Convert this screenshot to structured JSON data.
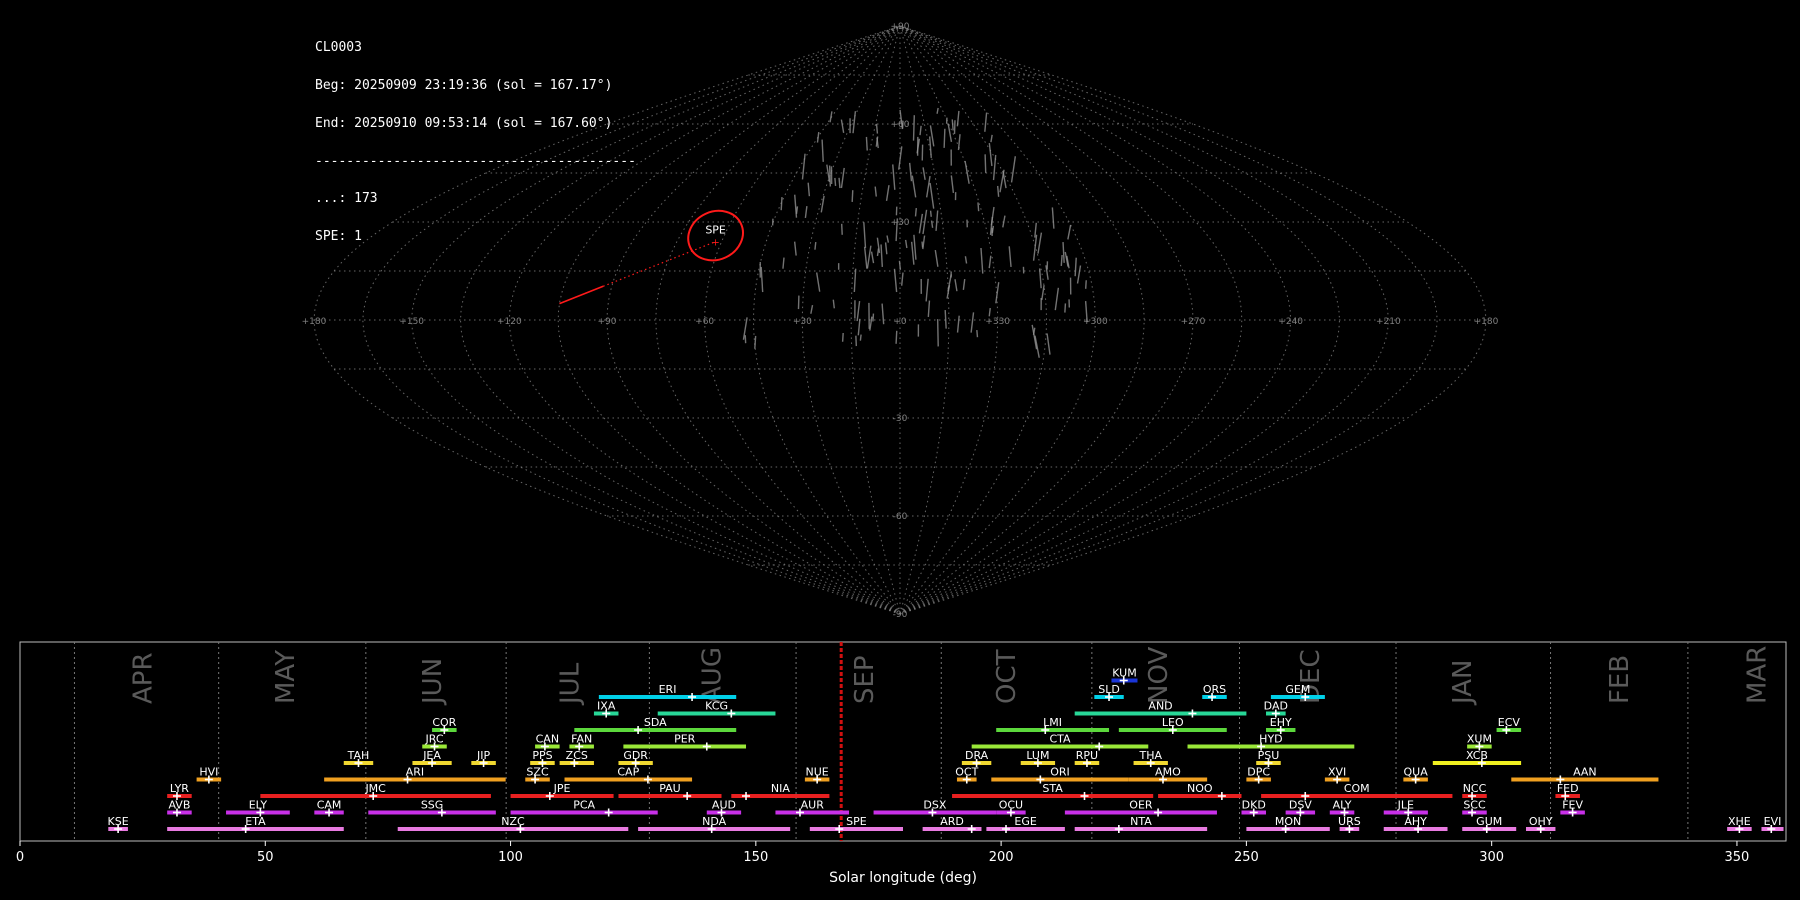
{
  "header": {
    "lines": [
      "CL0003",
      "Beg: 20250909 23:19:36 (sol = 167.17°)",
      "End: 20250910 09:53:14 (sol = 167.60°)",
      "-----------------------------------------",
      "...: 173",
      "SPE: 1"
    ]
  },
  "colors": {
    "background": "#000000",
    "grid": "#808080",
    "highlight": "#ff1a1a",
    "meteor": "#9a9a9a"
  },
  "sky_map": {
    "projection": "sinusoidal",
    "ra_labels": [
      "+180",
      "+150",
      "+120",
      "+90",
      "+60",
      "+30",
      "+0",
      "+330",
      "+300",
      "+270",
      "+240",
      "+210",
      "+180"
    ],
    "dec_labels": [
      "+90",
      "+60",
      "+30",
      "-30",
      "-60",
      "-90"
    ],
    "highlight_shower": {
      "code": "SPE",
      "ra": 62,
      "dec": 24
    },
    "highlight_meteor": {
      "ra_start": 105,
      "dec_start": 5,
      "ra_end": 62,
      "dec_end": 24
    }
  },
  "chart_data": {
    "type": "timeline",
    "xlabel": "Solar longitude (deg)",
    "xlim": [
      0,
      360
    ],
    "xticks": [
      0,
      50,
      100,
      150,
      200,
      250,
      300,
      350
    ],
    "current_sol": 167.4,
    "months": [
      {
        "label": "APR",
        "start": 11.1,
        "center": 25
      },
      {
        "label": "MAY",
        "start": 40.5,
        "center": 54
      },
      {
        "label": "JUN",
        "start": 70.5,
        "center": 84
      },
      {
        "label": "JUL",
        "start": 99.1,
        "center": 112
      },
      {
        "label": "AUG",
        "start": 128.3,
        "center": 141
      },
      {
        "label": "SEP",
        "start": 158.2,
        "center": 172
      },
      {
        "label": "OCT",
        "start": 187.8,
        "center": 201
      },
      {
        "label": "NOV",
        "start": 218.5,
        "center": 232
      },
      {
        "label": "DEC",
        "start": 248.6,
        "center": 263
      },
      {
        "label": "JAN",
        "start": 280.5,
        "center": 294
      },
      {
        "label": "FEB",
        "start": 312,
        "center": 326
      },
      {
        "label": "MAR",
        "start": 340,
        "center": 354
      }
    ],
    "showers": [
      {
        "code": "KUM",
        "start": 222.5,
        "end": 227.8,
        "peak": 225,
        "row": 10,
        "color": "#1a35d8"
      },
      {
        "code": "ERI",
        "start": 118,
        "end": 146,
        "peak": 137,
        "row": 9,
        "color": "#00d0e8"
      },
      {
        "code": "SLD",
        "start": 219,
        "end": 225,
        "peak": 222,
        "row": 9,
        "color": "#00d0e8"
      },
      {
        "code": "ORS",
        "start": 241,
        "end": 246,
        "peak": 243,
        "row": 9,
        "color": "#00d0e8"
      },
      {
        "code": "GEM",
        "start": 255,
        "end": 266,
        "peak": 262,
        "row": 9,
        "color": "#00d0e8"
      },
      {
        "code": "IXA",
        "start": 117,
        "end": 122,
        "peak": 119.5,
        "row": 8,
        "color": "#28d898"
      },
      {
        "code": "KCG",
        "start": 130,
        "end": 154,
        "peak": 145,
        "row": 8,
        "color": "#28d898"
      },
      {
        "code": "AND",
        "start": 215,
        "end": 250,
        "peak": 239,
        "row": 8,
        "color": "#28d898"
      },
      {
        "code": "DAD",
        "start": 254,
        "end": 258,
        "peak": 256,
        "row": 8,
        "color": "#28d898"
      },
      {
        "code": "COR",
        "start": 84,
        "end": 89,
        "peak": 86.5,
        "row": 7,
        "color": "#5cd83c"
      },
      {
        "code": "SDA",
        "start": 113,
        "end": 146,
        "peak": 126,
        "row": 7,
        "color": "#5cd83c"
      },
      {
        "code": "LMI",
        "start": 199,
        "end": 222,
        "peak": 209,
        "row": 7,
        "color": "#5cd83c"
      },
      {
        "code": "LEO",
        "start": 224,
        "end": 246,
        "peak": 235,
        "row": 7,
        "color": "#5cd83c"
      },
      {
        "code": "EHY",
        "start": 254,
        "end": 260,
        "peak": 257,
        "row": 7,
        "color": "#5cd83c"
      },
      {
        "code": "ECV",
        "start": 301,
        "end": 306,
        "peak": 303,
        "row": 7,
        "color": "#5cd83c"
      },
      {
        "code": "JRC",
        "start": 82,
        "end": 87,
        "peak": 84.5,
        "row": 6,
        "color": "#9ae838"
      },
      {
        "code": "CAN",
        "start": 105,
        "end": 110,
        "peak": 107,
        "row": 6,
        "color": "#9ae838"
      },
      {
        "code": "FAN",
        "start": 112,
        "end": 117,
        "peak": 114,
        "row": 6,
        "color": "#9ae838"
      },
      {
        "code": "PER",
        "start": 123,
        "end": 148,
        "peak": 140,
        "row": 6,
        "color": "#9ae838"
      },
      {
        "code": "CTA",
        "start": 194,
        "end": 230,
        "peak": 220,
        "row": 6,
        "color": "#9ae838"
      },
      {
        "code": "HYD",
        "start": 238,
        "end": 272,
        "peak": 253,
        "row": 6,
        "color": "#9ae838"
      },
      {
        "code": "XUM",
        "start": 295,
        "end": 300,
        "peak": 297.5,
        "row": 6,
        "color": "#9ae838"
      },
      {
        "code": "TAH",
        "start": 66,
        "end": 72,
        "peak": 69,
        "row": 5,
        "color": "#f0d830"
      },
      {
        "code": "JEA",
        "start": 80,
        "end": 88,
        "peak": 84,
        "row": 5,
        "color": "#f0d830"
      },
      {
        "code": "JIP",
        "start": 92,
        "end": 97,
        "peak": 94.5,
        "row": 5,
        "color": "#f0d830"
      },
      {
        "code": "PPS",
        "start": 104,
        "end": 109,
        "peak": 106.5,
        "row": 5,
        "color": "#f0d830"
      },
      {
        "code": "ZCS",
        "start": 110,
        "end": 117,
        "peak": 113,
        "row": 5,
        "color": "#f0d830"
      },
      {
        "code": "GDR",
        "start": 122,
        "end": 129,
        "peak": 125.5,
        "row": 5,
        "color": "#f0d830"
      },
      {
        "code": "DRA",
        "start": 192,
        "end": 198,
        "peak": 195,
        "row": 5,
        "color": "#f0d830"
      },
      {
        "code": "LUM",
        "start": 204,
        "end": 211,
        "peak": 207.5,
        "row": 5,
        "color": "#f0d830"
      },
      {
        "code": "RPU",
        "start": 215,
        "end": 220,
        "peak": 217.5,
        "row": 5,
        "color": "#f0d830"
      },
      {
        "code": "THA",
        "start": 227,
        "end": 234,
        "peak": 230.5,
        "row": 5,
        "color": "#f0d830"
      },
      {
        "code": "PSU",
        "start": 252,
        "end": 257,
        "peak": 254.5,
        "row": 5,
        "color": "#f0d830"
      },
      {
        "code": "XCB",
        "start": 288,
        "end": 306,
        "peak": 298,
        "row": 5,
        "color": "#f0f020"
      },
      {
        "code": "HVI",
        "start": 36,
        "end": 41,
        "peak": 38.5,
        "row": 4,
        "color": "#f0a020"
      },
      {
        "code": "ARI",
        "start": 62,
        "end": 99,
        "peak": 79,
        "row": 4,
        "color": "#f0a020"
      },
      {
        "code": "SZC",
        "start": 103,
        "end": 108,
        "peak": 105,
        "row": 4,
        "color": "#f0a020"
      },
      {
        "code": "CAP",
        "start": 111,
        "end": 137,
        "peak": 128,
        "row": 4,
        "color": "#f0a020"
      },
      {
        "code": "NUE",
        "start": 160,
        "end": 165,
        "peak": 162.5,
        "row": 4,
        "color": "#f0a020"
      },
      {
        "code": "OCT",
        "start": 191,
        "end": 195,
        "peak": 193,
        "row": 4,
        "color": "#f0a020"
      },
      {
        "code": "ORI",
        "start": 198,
        "end": 226,
        "peak": 208,
        "row": 4,
        "color": "#f0a020"
      },
      {
        "code": "AMO",
        "start": 226,
        "end": 242,
        "peak": 233,
        "row": 4,
        "color": "#f0a020"
      },
      {
        "code": "DPC",
        "start": 250,
        "end": 255,
        "peak": 252.5,
        "row": 4,
        "color": "#f0a020"
      },
      {
        "code": "XVI",
        "start": 266,
        "end": 271,
        "peak": 268.5,
        "row": 4,
        "color": "#f0a020"
      },
      {
        "code": "QUA",
        "start": 282,
        "end": 287,
        "peak": 284.5,
        "row": 4,
        "color": "#f0a020"
      },
      {
        "code": "AAN",
        "start": 304,
        "end": 334,
        "peak": 314,
        "row": 4,
        "color": "#f0a020"
      },
      {
        "code": "LYR",
        "start": 30,
        "end": 35,
        "peak": 32,
        "row": 3,
        "color": "#e82020"
      },
      {
        "code": "JMC",
        "start": 49,
        "end": 96,
        "peak": 72,
        "row": 3,
        "color": "#e82020"
      },
      {
        "code": "JPE",
        "start": 100,
        "end": 121,
        "peak": 108,
        "row": 3,
        "color": "#e82020"
      },
      {
        "code": "PAU",
        "start": 122,
        "end": 143,
        "peak": 136,
        "row": 3,
        "color": "#e82020"
      },
      {
        "code": "NIA",
        "start": 145,
        "end": 165,
        "peak": 148,
        "row": 3,
        "color": "#e82020"
      },
      {
        "code": "STA",
        "start": 190,
        "end": 231,
        "peak": 217,
        "row": 3,
        "color": "#e82020"
      },
      {
        "code": "NOO",
        "start": 232,
        "end": 249,
        "peak": 245,
        "row": 3,
        "color": "#e82020"
      },
      {
        "code": "COM",
        "start": 253,
        "end": 292,
        "peak": 262,
        "row": 3,
        "color": "#e82020"
      },
      {
        "code": "NCC",
        "start": 294,
        "end": 299,
        "peak": 296,
        "row": 3,
        "color": "#e82020"
      },
      {
        "code": "FED",
        "start": 313,
        "end": 318,
        "peak": 315,
        "row": 3,
        "color": "#e82020"
      },
      {
        "code": "AVB",
        "start": 30,
        "end": 35,
        "peak": 32,
        "row": 2,
        "color": "#c830e8"
      },
      {
        "code": "ELY",
        "start": 42,
        "end": 55,
        "peak": 49,
        "row": 2,
        "color": "#c830e8"
      },
      {
        "code": "CAM",
        "start": 60,
        "end": 66,
        "peak": 63,
        "row": 2,
        "color": "#c830e8"
      },
      {
        "code": "SSG",
        "start": 71,
        "end": 97,
        "peak": 86,
        "row": 2,
        "color": "#c830e8"
      },
      {
        "code": "PCA",
        "start": 100,
        "end": 130,
        "peak": 120,
        "row": 2,
        "color": "#c830e8"
      },
      {
        "code": "AUD",
        "start": 140,
        "end": 147,
        "peak": 143,
        "row": 2,
        "color": "#c830e8"
      },
      {
        "code": "AUR",
        "start": 154,
        "end": 169,
        "peak": 159,
        "row": 2,
        "color": "#c830e8"
      },
      {
        "code": "DSX",
        "start": 174,
        "end": 199,
        "peak": 186,
        "row": 2,
        "color": "#c830e8"
      },
      {
        "code": "OCU",
        "start": 199,
        "end": 205,
        "peak": 202,
        "row": 2,
        "color": "#c830e8"
      },
      {
        "code": "OER",
        "start": 213,
        "end": 244,
        "peak": 232,
        "row": 2,
        "color": "#c830e8"
      },
      {
        "code": "DKD",
        "start": 249,
        "end": 254,
        "peak": 251.5,
        "row": 2,
        "color": "#c830e8"
      },
      {
        "code": "DSV",
        "start": 258,
        "end": 264,
        "peak": 261,
        "row": 2,
        "color": "#c830e8"
      },
      {
        "code": "ALY",
        "start": 267,
        "end": 272,
        "peak": 270,
        "row": 2,
        "color": "#c830e8"
      },
      {
        "code": "JLE",
        "start": 278,
        "end": 287,
        "peak": 283,
        "row": 2,
        "color": "#c830e8"
      },
      {
        "code": "SCC",
        "start": 294,
        "end": 299,
        "peak": 296,
        "row": 2,
        "color": "#c830e8"
      },
      {
        "code": "FEV",
        "start": 314,
        "end": 319,
        "peak": 316.5,
        "row": 2,
        "color": "#c830e8"
      },
      {
        "code": "KSE",
        "start": 18,
        "end": 22,
        "peak": 20,
        "row": 1,
        "color": "#e87ae0"
      },
      {
        "code": "ETA",
        "start": 30,
        "end": 66,
        "peak": 46,
        "row": 1,
        "color": "#e87ae0"
      },
      {
        "code": "NZC",
        "start": 77,
        "end": 124,
        "peak": 102,
        "row": 1,
        "color": "#e87ae0"
      },
      {
        "code": "NDA",
        "start": 126,
        "end": 157,
        "peak": 141,
        "row": 1,
        "color": "#e87ae0"
      },
      {
        "code": "SPE",
        "start": 161,
        "end": 180,
        "peak": 167,
        "row": 1,
        "color": "#e87ae0"
      },
      {
        "code": "ARD",
        "start": 184,
        "end": 196,
        "peak": 194,
        "row": 1,
        "color": "#e87ae0"
      },
      {
        "code": "EGE",
        "start": 197,
        "end": 213,
        "peak": 201,
        "row": 1,
        "color": "#e87ae0"
      },
      {
        "code": "NTA",
        "start": 215,
        "end": 242,
        "peak": 224,
        "row": 1,
        "color": "#e87ae0"
      },
      {
        "code": "MON",
        "start": 250,
        "end": 267,
        "peak": 258,
        "row": 1,
        "color": "#e87ae0"
      },
      {
        "code": "URS",
        "start": 269,
        "end": 273,
        "peak": 271,
        "row": 1,
        "color": "#e87ae0"
      },
      {
        "code": "AHY",
        "start": 278,
        "end": 291,
        "peak": 285,
        "row": 1,
        "color": "#e87ae0"
      },
      {
        "code": "GUM",
        "start": 294,
        "end": 305,
        "peak": 299,
        "row": 1,
        "color": "#e87ae0"
      },
      {
        "code": "OHY",
        "start": 307,
        "end": 313,
        "peak": 310,
        "row": 1,
        "color": "#e87ae0"
      },
      {
        "code": "XHE",
        "start": 348,
        "end": 353,
        "peak": 350.5,
        "row": 1,
        "color": "#e87ae0"
      },
      {
        "code": "EVI",
        "start": 355,
        "end": 359.5,
        "peak": 357,
        "row": 1,
        "color": "#e87ae0"
      }
    ]
  }
}
